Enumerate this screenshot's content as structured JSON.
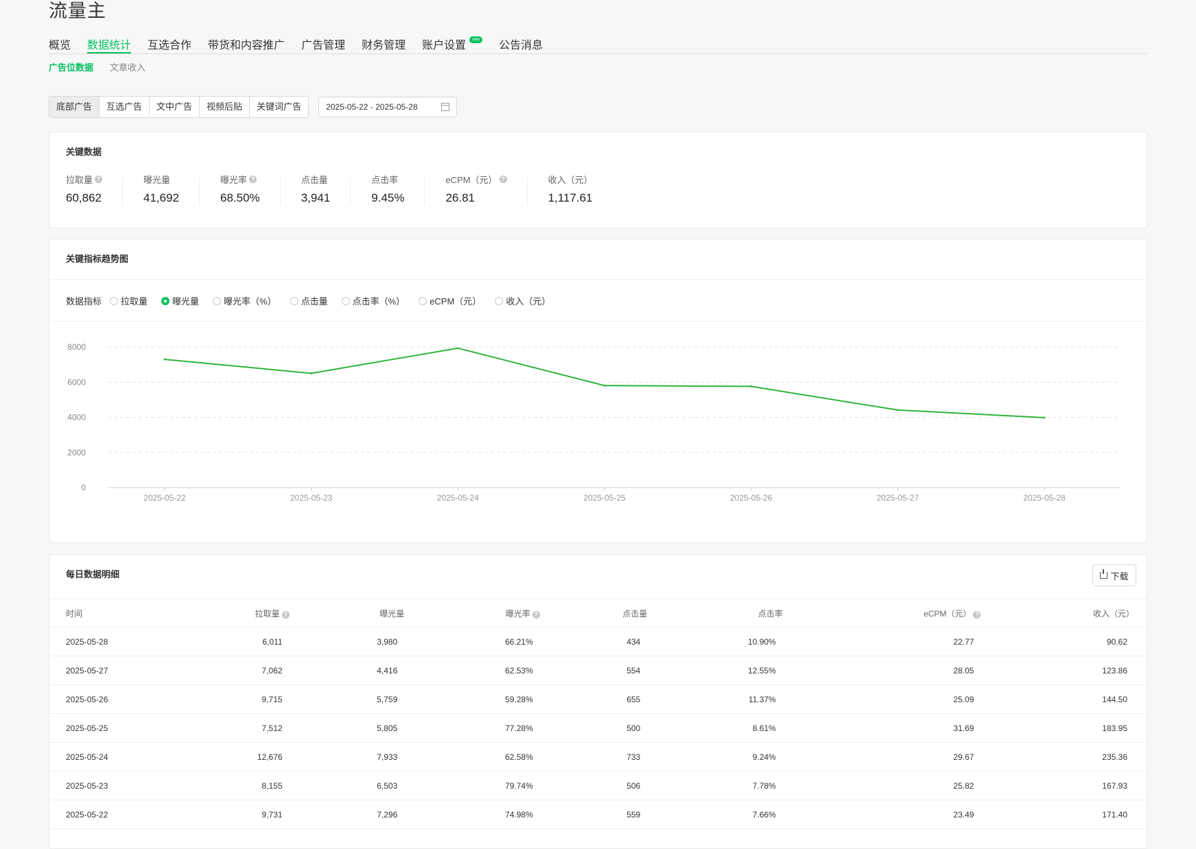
{
  "app_title": "流量主",
  "main_nav": [
    {
      "label": "概览"
    },
    {
      "label": "数据统计",
      "active": true
    },
    {
      "label": "互选合作"
    },
    {
      "label": "带货和内容推广"
    },
    {
      "label": "广告管理"
    },
    {
      "label": "财务管理"
    },
    {
      "label": "账户设置",
      "badge": "new"
    },
    {
      "label": "公告消息"
    }
  ],
  "sub_nav": [
    {
      "label": "广告位数据",
      "active": true
    },
    {
      "label": "文章收入"
    }
  ],
  "ad_types": [
    "底部广告",
    "互选广告",
    "文中广告",
    "视频后贴",
    "关键词广告"
  ],
  "date_range": "2025-05-22 - 2025-05-28",
  "key_data": {
    "title": "关键数据",
    "metrics": [
      {
        "label": "拉取量",
        "value": "60,862",
        "help": true
      },
      {
        "label": "曝光量",
        "value": "41,692"
      },
      {
        "label": "曝光率",
        "value": "68.50%",
        "help": true
      },
      {
        "label": "点击量",
        "value": "3,941"
      },
      {
        "label": "点击率",
        "value": "9.45%"
      },
      {
        "label": "eCPM（元）",
        "value": "26.81",
        "help": true
      },
      {
        "label": "收入（元）",
        "value": "1,117.61"
      }
    ]
  },
  "trend": {
    "title": "关键指标趋势图",
    "indicator_label": "数据指标",
    "indicators": [
      {
        "label": "拉取量"
      },
      {
        "label": "曝光量",
        "checked": true
      },
      {
        "label": "曝光率（%）"
      },
      {
        "label": "点击量"
      },
      {
        "label": "点击率（%）"
      },
      {
        "label": "eCPM（元）"
      },
      {
        "label": "收入（元）"
      }
    ]
  },
  "chart_data": {
    "type": "line",
    "x": [
      "2025-05-22",
      "2025-05-23",
      "2025-05-24",
      "2025-05-25",
      "2025-05-26",
      "2025-05-27",
      "2025-05-28"
    ],
    "series": [
      {
        "values": [
          7296,
          6503,
          7933,
          5805,
          5759,
          4416,
          3980
        ]
      }
    ],
    "yticks": [
      0,
      2000,
      4000,
      6000,
      8000
    ],
    "ylim": [
      0,
      8000
    ],
    "grid": true,
    "line_color": "#2fb43a"
  },
  "table": {
    "title": "每日数据明细",
    "download_label": "下载",
    "columns": [
      {
        "label": "时间"
      },
      {
        "label": "拉取量",
        "help": true
      },
      {
        "label": "曝光量"
      },
      {
        "label": "曝光率",
        "help": true
      },
      {
        "label": "点击量"
      },
      {
        "label": "点击率"
      },
      {
        "label": "eCPM（元）",
        "help": true
      },
      {
        "label": "收入（元）"
      }
    ],
    "rows": [
      [
        "2025-05-28",
        "6,011",
        "3,980",
        "66.21%",
        "434",
        "10.90%",
        "22.77",
        "90.62"
      ],
      [
        "2025-05-27",
        "7,062",
        "4,416",
        "62.53%",
        "554",
        "12.55%",
        "28.05",
        "123.86"
      ],
      [
        "2025-05-26",
        "9,715",
        "5,759",
        "59.28%",
        "655",
        "11.37%",
        "25.09",
        "144.50"
      ],
      [
        "2025-05-25",
        "7,512",
        "5,805",
        "77.28%",
        "500",
        "8.61%",
        "31.69",
        "183.95"
      ],
      [
        "2025-05-24",
        "12,676",
        "7,933",
        "62.58%",
        "733",
        "9.24%",
        "29.67",
        "235.36"
      ],
      [
        "2025-05-23",
        "8,155",
        "6,503",
        "79.74%",
        "506",
        "7.78%",
        "25.82",
        "167.93"
      ],
      [
        "2025-05-22",
        "9,731",
        "7,296",
        "74.98%",
        "559",
        "7.66%",
        "23.49",
        "171.40"
      ]
    ]
  },
  "colors": {
    "accent": "#07c160",
    "line": "#2fb43a"
  }
}
